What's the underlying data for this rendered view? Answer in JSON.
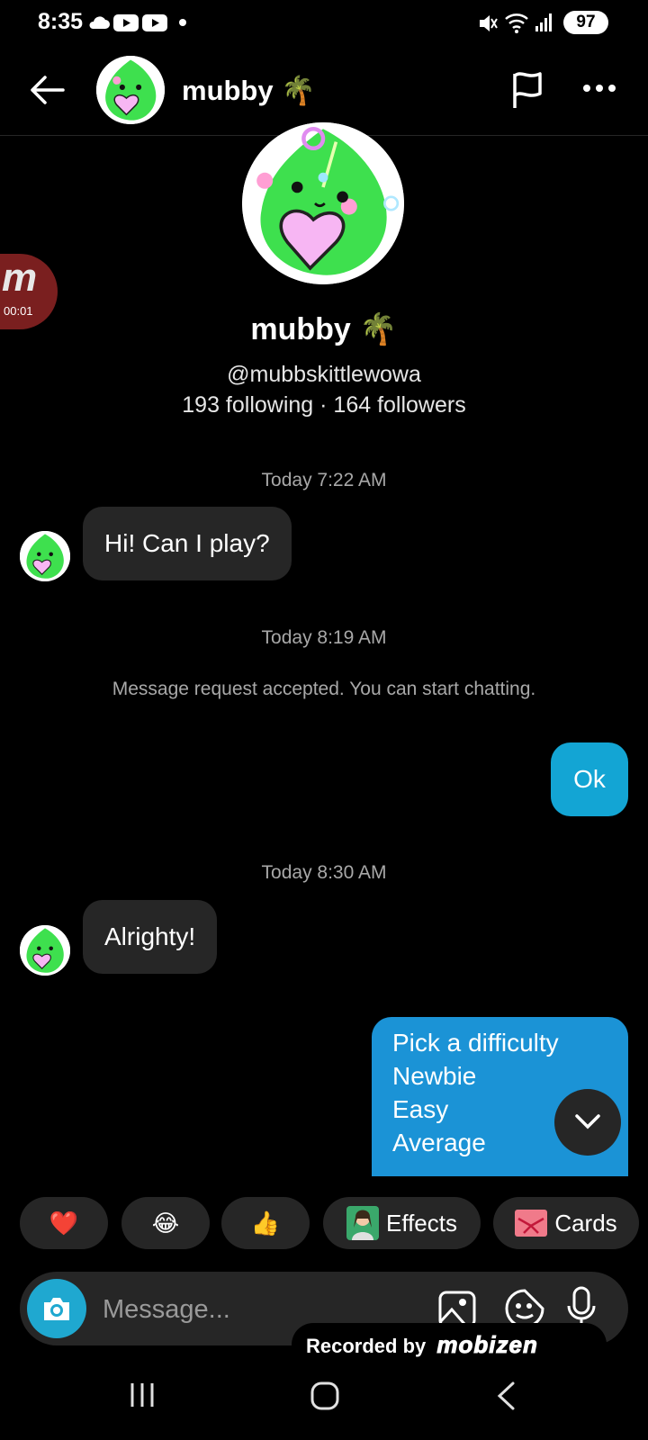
{
  "status_bar": {
    "time": "8:35",
    "battery": "97"
  },
  "header": {
    "name": "mubby",
    "name_emoji": "🌴"
  },
  "profile": {
    "name": "mubby",
    "name_emoji": "🌴",
    "handle": "@mubbskittlewowa",
    "stats": "193 following · 164 followers"
  },
  "recorder": {
    "badge_letter": "m",
    "elapsed": "00:01"
  },
  "messages": [
    {
      "timestamp": "Today 7:22 AM"
    },
    {
      "text": "Hi! Can I play?"
    },
    {
      "timestamp": "Today 8:19 AM"
    },
    {
      "system": "Message request accepted. You can start chatting."
    },
    {
      "text": "Ok"
    },
    {
      "timestamp": "Today 8:30 AM"
    },
    {
      "text": "Alrighty!"
    },
    {
      "lines": [
        "Pick a difficulty",
        "Newbie",
        "Easy",
        "Average"
      ]
    }
  ],
  "quick_reactions": [
    "❤️",
    "😂",
    "👍"
  ],
  "chips": {
    "effects": "Effects",
    "cards": "Cards"
  },
  "composer": {
    "placeholder": "Message..."
  },
  "watermark": {
    "prefix": "Recorded by",
    "brand": "mobizen"
  },
  "colors": {
    "outgoing_bubble": "#13a5d4",
    "incoming_bubble": "#262626",
    "camera_button": "#1fa8d0"
  }
}
